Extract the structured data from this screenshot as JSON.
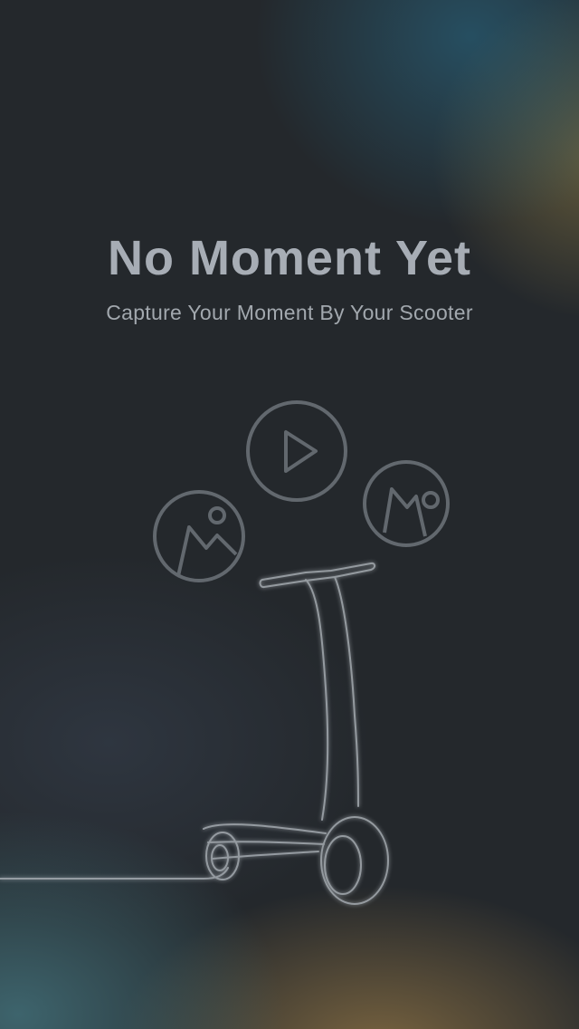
{
  "empty_state": {
    "title": "No Moment Yet",
    "subtitle": "Capture Your Moment By Your Scooter"
  },
  "illustration": {
    "icons": [
      "image-icon",
      "play-icon",
      "image-icon"
    ],
    "object": "scooter-line-art"
  },
  "colors": {
    "background": "#24282c",
    "title": "#a7adb5",
    "subtitle": "#a2a8ae",
    "line_art": "#8e9399"
  }
}
